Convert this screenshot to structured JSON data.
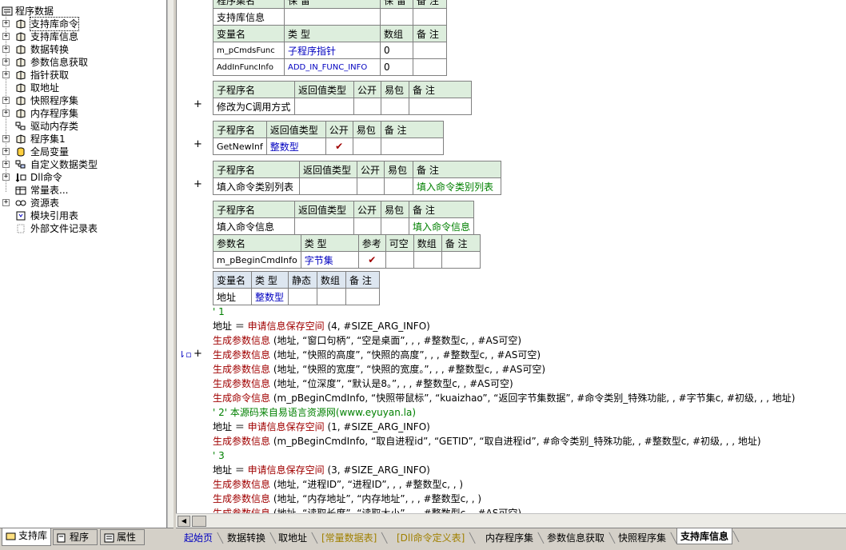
{
  "tree": {
    "root": "程序数据",
    "items": [
      {
        "label": "支持库命令",
        "expander": "+",
        "icon": "book-icon"
      },
      {
        "label": "支持库信息",
        "expander": "+",
        "icon": "book-icon"
      },
      {
        "label": "数据转换",
        "expander": "+",
        "icon": "book-icon"
      },
      {
        "label": "参数信息获取",
        "expander": "+",
        "icon": "book-icon"
      },
      {
        "label": "指针获取",
        "expander": "+",
        "icon": "book-icon"
      },
      {
        "label": "取地址",
        "expander": "",
        "icon": "book-icon"
      },
      {
        "label": "快照程序集",
        "expander": "+",
        "icon": "book-icon"
      },
      {
        "label": "内存程序集",
        "expander": "+",
        "icon": "book-icon"
      },
      {
        "label": "驱动内存类",
        "expander": "",
        "icon": "class-icon"
      },
      {
        "label": "程序集1",
        "expander": "+",
        "icon": "book-icon"
      },
      {
        "label": "全局变量",
        "expander": "+",
        "icon": "database-icon"
      },
      {
        "label": "自定义数据类型",
        "expander": "+",
        "icon": "datatype-icon"
      },
      {
        "label": "Dll命令",
        "expander": "+",
        "icon": "dll-icon"
      },
      {
        "label": "常量表...",
        "expander": "",
        "icon": "constants-icon"
      },
      {
        "label": "资源表",
        "expander": "+",
        "icon": "resource-icon"
      },
      {
        "label": "模块引用表",
        "expander": "",
        "icon": "module-icon"
      },
      {
        "label": "外部文件记录表",
        "expander": "",
        "icon": "file-icon"
      }
    ]
  },
  "left_tabs": [
    {
      "label": "支持库",
      "icon": "library-icon"
    },
    {
      "label": "程序",
      "icon": "program-icon"
    },
    {
      "label": "属性",
      "icon": "properties-icon"
    }
  ],
  "top_table": {
    "hdr_partial": [
      "程序集名",
      "保 留",
      "保 留",
      "备 注"
    ],
    "row1": [
      "支持库信息",
      "",
      "",
      ""
    ],
    "var_hdr": [
      "变量名",
      "类 型",
      "数组",
      "备 注"
    ],
    "vars": [
      [
        "m_pCmdsFunc",
        "子程序指针",
        "0",
        ""
      ],
      [
        "AddInFuncInfo",
        "ADD_IN_FUNC_INFO",
        "0",
        ""
      ]
    ]
  },
  "sub_hdr": [
    "子程序名",
    "返回值类型",
    "公开",
    "易包",
    "备 注"
  ],
  "sub1": {
    "name": "修改为C调用方式",
    "ret": "",
    "note": ""
  },
  "sub2": {
    "name": "GetNewInf",
    "ret": "整数型",
    "note": ""
  },
  "sub3": {
    "name": "填入命令类别列表",
    "ret": "",
    "note": "填入命令类别列表"
  },
  "sub4": {
    "name": "填入命令信息",
    "ret": "",
    "note": "填入命令信息"
  },
  "param_hdr": [
    "参数名",
    "类 型",
    "参考",
    "可空",
    "数组",
    "备 注"
  ],
  "param1": {
    "name": "m_pBeginCmdInfo",
    "type": "字节集"
  },
  "local_hdr": [
    "变量名",
    "类 型",
    "静态",
    "数组",
    "备 注"
  ],
  "local1": {
    "name": "地址",
    "type": "整数型"
  },
  "check_mark": "✔",
  "margin_plus": "+",
  "code": [
    {
      "t": "comment",
      "text": "' 1"
    },
    {
      "t": "plain",
      "text": "地址 ＝ ",
      "fn": "申请信息保存空间",
      "rest": " (4, #SIZE_ARG_INFO)"
    },
    {
      "t": "call",
      "fn": "生成参数信息",
      "rest": " (地址, “窗口句柄”, “空是桌面”, , , #整数型c, , #AS可空)"
    },
    {
      "t": "call",
      "fn": "生成参数信息",
      "rest": " (地址, “快照的高度”, “快照的高度”, , , #整数型c, , #AS可空)"
    },
    {
      "t": "call",
      "fn": "生成参数信息",
      "rest": " (地址, “快照的宽度”, “快照的宽度。”, , , #整数型c, , #AS可空)"
    },
    {
      "t": "call",
      "fn": "生成参数信息",
      "rest": " (地址, “位深度”, “默认是8。”, , , #整数型c, , #AS可空)"
    },
    {
      "t": "call",
      "fn": "生成命令信息",
      "rest": " (m_pBeginCmdInfo, “快照带鼠标”, “kuaizhao”, “返回字节集数据”, #命令类别_特殊功能, , #字节集c, #初级, , , 地址)"
    },
    {
      "t": "comment",
      "text": "' 2' 本源码来自易语言资源网(www.eyuyan.la)"
    },
    {
      "t": "plain",
      "text": "地址 ＝ ",
      "fn": "申请信息保存空间",
      "rest": " (1, #SIZE_ARG_INFO)"
    },
    {
      "t": "call",
      "fn": "生成参数信息",
      "rest": " (m_pBeginCmdInfo, “取自进程id”, “GETID”, “取自进程id”, #命令类别_特殊功能, , #整数型c, #初级, , , 地址)"
    },
    {
      "t": "comment",
      "text": "' 3"
    },
    {
      "t": "plain",
      "text": "地址 ＝ ",
      "fn": "申请信息保存空间",
      "rest": " (3, #SIZE_ARG_INFO)"
    },
    {
      "t": "call",
      "fn": "生成参数信息",
      "rest": " (地址, “进程ID”, “进程ID”, , , #整数型c, , )"
    },
    {
      "t": "call",
      "fn": "生成参数信息",
      "rest": " (地址, “内存地址”, “内存地址”, , , #整数型c, , )"
    },
    {
      "t": "call",
      "fn": "生成参数信息",
      "rest": " (地址, “读取长度”, “读取大小”, , , #整数型c, , #AS可空)"
    }
  ],
  "doc_tabs": [
    {
      "label": "起始页",
      "style": "blue"
    },
    {
      "label": "数据转换",
      "style": ""
    },
    {
      "label": "取地址",
      "style": ""
    },
    {
      "label": "[常量数据表]",
      "style": "yellow"
    },
    {
      "label": "[Dll命令定义表]",
      "style": "yellow"
    },
    {
      "label": "内存程序集",
      "style": ""
    },
    {
      "label": "参数信息获取",
      "style": ""
    },
    {
      "label": "快照程序集",
      "style": ""
    },
    {
      "label": "支持库信息",
      "style": "active"
    }
  ]
}
